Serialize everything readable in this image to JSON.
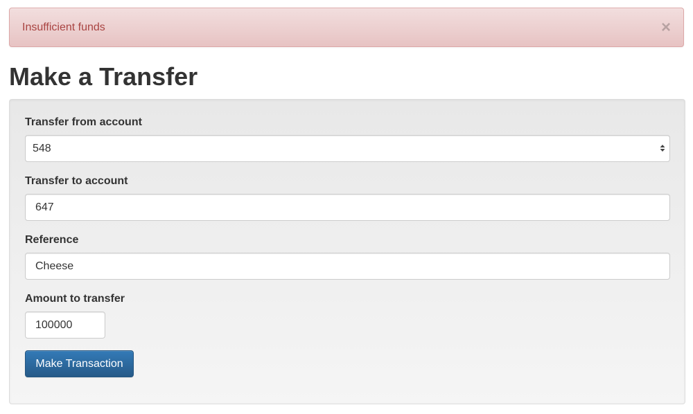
{
  "alert": {
    "message": "Insufficient funds",
    "close_label": "×"
  },
  "page": {
    "title": "Make a Transfer"
  },
  "form": {
    "from_account": {
      "label": "Transfer from account",
      "selected_value": "548"
    },
    "to_account": {
      "label": "Transfer to account",
      "value": "647"
    },
    "reference": {
      "label": "Reference",
      "value": "Cheese"
    },
    "amount": {
      "label": "Amount to transfer",
      "value": "100000"
    },
    "submit_label": "Make Transaction"
  },
  "colors": {
    "alert_text": "#a94442",
    "alert_bg": "#f2dede",
    "primary": "#337ab7"
  }
}
